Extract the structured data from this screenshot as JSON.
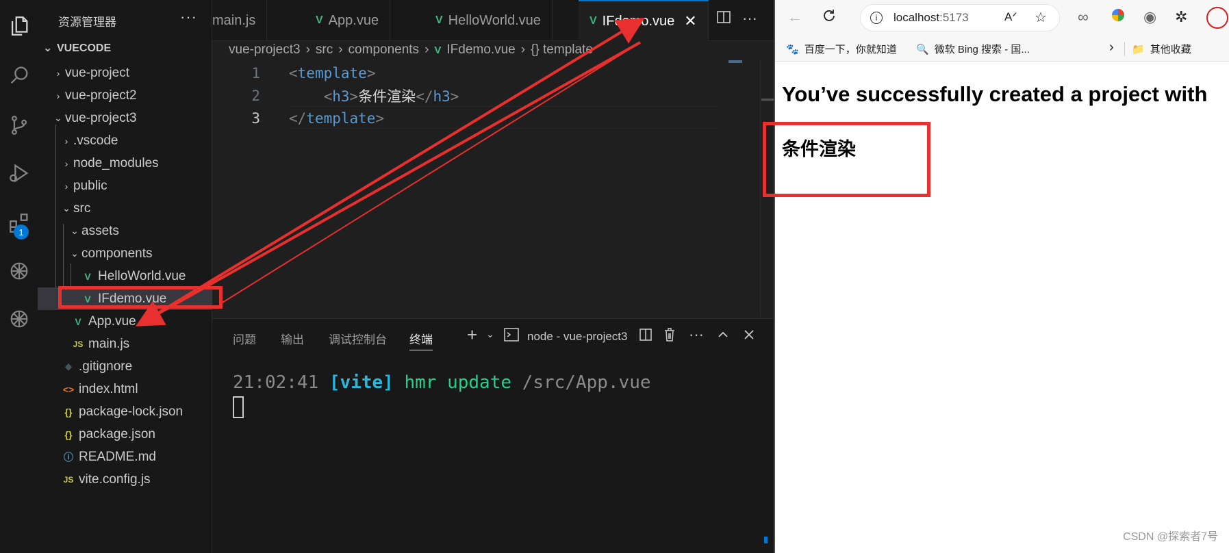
{
  "vscode": {
    "explorer_title": "资源管理器",
    "more": "···",
    "root_folder": "VUECODE",
    "tree": [
      {
        "label": "vue-project",
        "chev": "›",
        "icon": ""
      },
      {
        "label": "vue-project2",
        "chev": "›",
        "icon": ""
      },
      {
        "label": "vue-project3",
        "chev": "⌄",
        "icon": ""
      },
      {
        "label": ".vscode",
        "chev": "›",
        "icon": ""
      },
      {
        "label": "node_modules",
        "chev": "›",
        "icon": ""
      },
      {
        "label": "public",
        "chev": "›",
        "icon": ""
      },
      {
        "label": "src",
        "chev": "⌄",
        "icon": ""
      },
      {
        "label": "assets",
        "chev": "⌄",
        "icon": ""
      },
      {
        "label": "components",
        "chev": "⌄",
        "icon": ""
      },
      {
        "label": "HelloWorld.vue",
        "chev": "",
        "icon": "V"
      },
      {
        "label": "IFdemo.vue",
        "chev": "",
        "icon": "V"
      },
      {
        "label": "App.vue",
        "chev": "",
        "icon": "V"
      },
      {
        "label": "main.js",
        "chev": "",
        "icon": "JS"
      },
      {
        "label": ".gitignore",
        "chev": "",
        "icon": "◆"
      },
      {
        "label": "index.html",
        "chev": "",
        "icon": "<>"
      },
      {
        "label": "package-lock.json",
        "chev": "",
        "icon": "{}"
      },
      {
        "label": "package.json",
        "chev": "",
        "icon": "{}"
      },
      {
        "label": "README.md",
        "chev": "",
        "icon": "ⓘ"
      },
      {
        "label": "vite.config.js",
        "chev": "",
        "icon": "JS"
      }
    ],
    "tabs": [
      {
        "label": "main.js"
      },
      {
        "label": "App.vue"
      },
      {
        "label": "HelloWorld.vue"
      },
      {
        "label": "IFdemo.vue"
      }
    ],
    "tab_close": "✕",
    "breadcrumb": [
      "vue-project3",
      "src",
      "components",
      "IFdemo.vue",
      "{} template"
    ],
    "code": {
      "line_numbers": [
        "1",
        "2",
        "3"
      ],
      "line1": {
        "open": "<",
        "tag": "template",
        "close": ">"
      },
      "line2": {
        "indent": "    ",
        "open": "<",
        "tag": "h3",
        "close": ">",
        "text": "条件渲染",
        "open2": "</",
        "tag2": "h3",
        "close2": ">"
      },
      "line3": {
        "open": "</",
        "tag": "template",
        "close": ">"
      }
    },
    "activity_badge": "1",
    "panel": {
      "tabs": [
        "问题",
        "输出",
        "调试控制台",
        "终端"
      ],
      "terminal_name": "node - vue-project3",
      "output": {
        "time": "21:02:41",
        "vite": "[vite]",
        "hmr": "hmr update",
        "path": "/src/App.vue"
      }
    }
  },
  "browser": {
    "url_host": "localhost",
    "url_port": ":5173",
    "bookmarks": [
      "百度一下，你就知道",
      "微软 Bing 搜索 - 国...",
      "其他收藏"
    ],
    "page_heading": "You’ve successfully created a project with",
    "page_h3": "条件渲染",
    "watermark": "CSDN @探索者7号"
  },
  "colors": {
    "annotation_red": "#e8302f",
    "vue_green": "#41b883",
    "accent_blue": "#0078d4"
  }
}
